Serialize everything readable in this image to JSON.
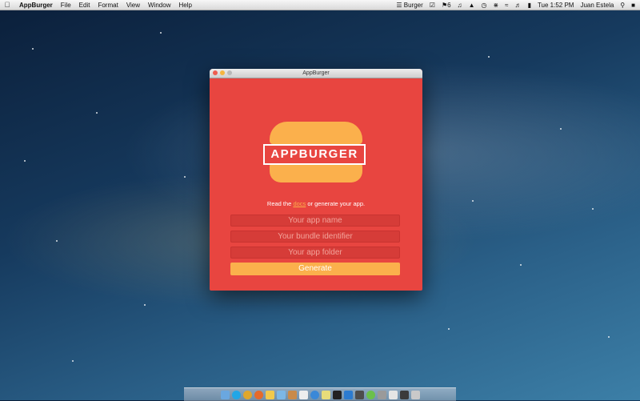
{
  "menubar": {
    "apple_icon": "apple-icon",
    "app_name": "AppBurger",
    "menus": [
      "File",
      "Edit",
      "Format",
      "View",
      "Window",
      "Help"
    ],
    "status": {
      "burger_label": "Burger",
      "notifications_count": "6",
      "clock": "Tue 1:52 PM",
      "user": "Juan Estela"
    }
  },
  "window": {
    "title": "AppBurger",
    "logo_text": "APPBURGER",
    "intro": {
      "before": "Read the ",
      "link": "docs",
      "after": " or generate your app."
    },
    "fields": {
      "app_name_placeholder": "Your app name",
      "bundle_id_placeholder": "Your bundle identifier",
      "app_folder_placeholder": "Your app folder"
    },
    "generate_label": "Generate",
    "colors": {
      "background": "#e84540",
      "bun": "#fbb04c",
      "field": "#d63c38",
      "placeholder": "#f2a39a"
    }
  },
  "dock": {
    "icons": [
      "finder-icon",
      "skype-icon",
      "chrome-icon",
      "firefox-icon",
      "adium-icon",
      "folder-icon",
      "photos-icon",
      "calendar-icon",
      "safari-icon",
      "notes-icon",
      "terminal-icon",
      "app-icon",
      "sublime-icon",
      "itunes-icon",
      "preferences-icon",
      "activity-icon",
      "finder-window-icon",
      "trash-icon"
    ]
  }
}
